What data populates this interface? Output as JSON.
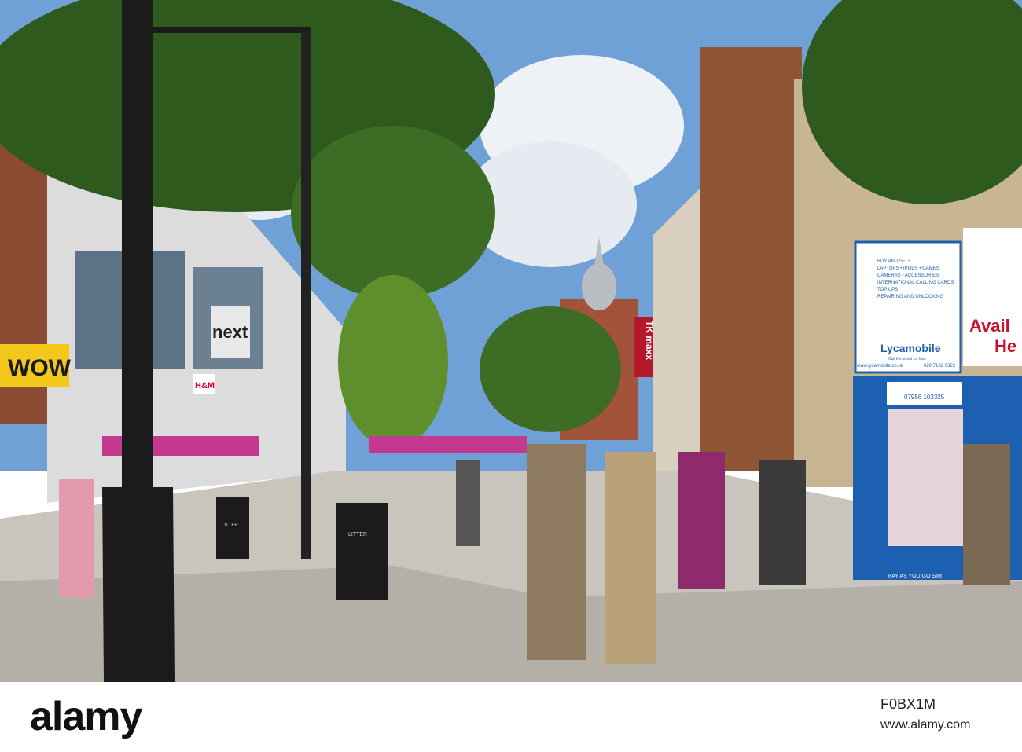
{
  "scene": {
    "description_free": true,
    "signs": {
      "wow": "WOW",
      "next": "next",
      "hm": "H&M",
      "tkmaxx": "TK maxx",
      "lycamobile": "Lycamobile",
      "lycamobile_sub": "Call the world for less",
      "lycamobile_url": "www.lycamobile.co.uk",
      "lycamobile_phone": "020 7132 0322",
      "phone_shop_lines": [
        "BUY AND SELL",
        "LAPTOPS • IPODS • GAMES",
        "CAMERAS • ACCESSORIES",
        "INTERNATIONAL CALLING CARDS",
        "TOP UPS",
        "REPAIRING AND UNLOCKING"
      ],
      "avail_line1": "Avail",
      "avail_line2": "He",
      "litter1": "LITTER",
      "litter2": "LITTER",
      "kiosk_phone": "07956 103325",
      "pay_as_you_go": "PAY AS YOU GO SIM"
    },
    "colors": {
      "sky": "#6fa0d6",
      "pavement": "#c9c4bc",
      "foliage": "#2f5a1e",
      "kiosk_blue": "#1d5fb0",
      "wow_yellow": "#f3c81b",
      "tkmaxx_red": "#b5182a",
      "canopy_pink": "#c2398f"
    }
  },
  "watermark": {
    "logo": "alamy",
    "image_id": "F0BX1M",
    "url": "www.alamy.com"
  }
}
